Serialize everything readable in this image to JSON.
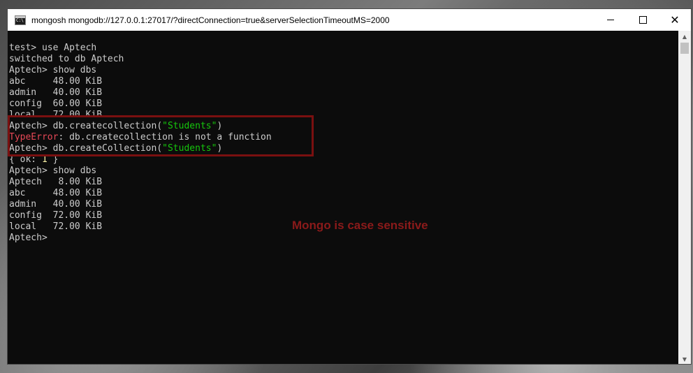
{
  "window": {
    "title": "mongosh mongodb://127.0.0.1:27017/?directConnection=true&serverSelectionTimeoutMS=2000"
  },
  "terminal": {
    "lines": [
      [
        {
          "t": "test> use Aptech",
          "c": "default"
        }
      ],
      [
        {
          "t": "switched to db Aptech",
          "c": "default"
        }
      ],
      [
        {
          "t": "Aptech> show dbs",
          "c": "default"
        }
      ],
      [
        {
          "t": "abc     48.00 KiB",
          "c": "default"
        }
      ],
      [
        {
          "t": "admin   40.00 KiB",
          "c": "default"
        }
      ],
      [
        {
          "t": "config  60.00 KiB",
          "c": "default"
        }
      ],
      [
        {
          "t": "local   72.00 KiB",
          "c": "default"
        }
      ],
      [
        {
          "t": "Aptech> db.createcollection(",
          "c": "default"
        },
        {
          "t": "\"Students\"",
          "c": "string"
        },
        {
          "t": ")",
          "c": "default"
        }
      ],
      [
        {
          "t": "TypeError",
          "c": "error"
        },
        {
          "t": ": db.createcollection is not a function",
          "c": "default"
        }
      ],
      [
        {
          "t": "Aptech> db.createCollection(",
          "c": "default"
        },
        {
          "t": "\"Students\"",
          "c": "string"
        },
        {
          "t": ")",
          "c": "default"
        }
      ],
      [
        {
          "t": "{ ok: ",
          "c": "default"
        },
        {
          "t": "1",
          "c": "number"
        },
        {
          "t": " }",
          "c": "default"
        }
      ],
      [
        {
          "t": "Aptech> show dbs",
          "c": "default"
        }
      ],
      [
        {
          "t": "Aptech   8.00 KiB",
          "c": "default"
        }
      ],
      [
        {
          "t": "abc     48.00 KiB",
          "c": "default"
        }
      ],
      [
        {
          "t": "admin   40.00 KiB",
          "c": "default"
        }
      ],
      [
        {
          "t": "config  72.00 KiB",
          "c": "default"
        }
      ],
      [
        {
          "t": "local   72.00 KiB",
          "c": "default"
        }
      ],
      [
        {
          "t": "Aptech> ",
          "c": "default"
        }
      ]
    ]
  },
  "annotation": {
    "text": "Mongo is case sensitive"
  },
  "colors": {
    "console_bg": "#0c0c0c",
    "console_fg": "#cccccc",
    "string": "#16c60c",
    "error": "#e74856",
    "number": "#f9f1a5",
    "highlight": "#7a1010",
    "annotation": "#8b1a1a"
  },
  "icons": {
    "app": "terminal-icon",
    "minimize": "minimize-icon",
    "maximize": "maximize-icon",
    "close": "close-icon",
    "scroll_up": "scroll-up-arrow-icon",
    "scroll_down": "scroll-down-arrow-icon"
  }
}
